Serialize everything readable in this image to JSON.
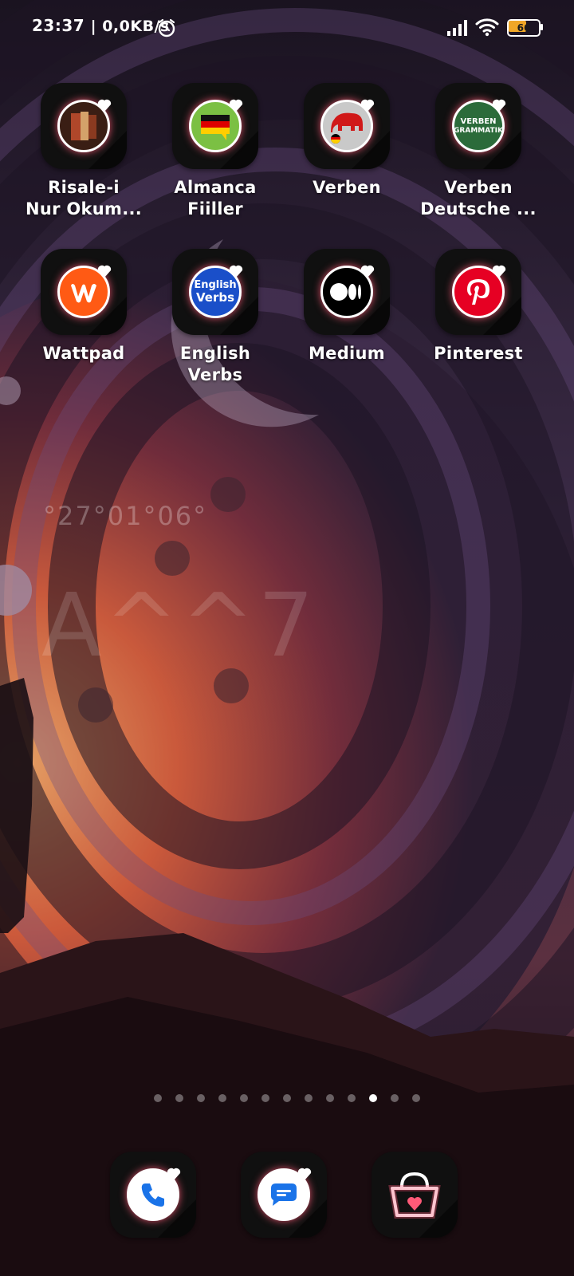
{
  "status_bar": {
    "time": "23:37",
    "net_speed": "| 0,0KB/s",
    "battery_level": "66",
    "icons": [
      "alarm-icon",
      "signal-icon",
      "wifi-icon",
      "battery-icon"
    ]
  },
  "widget": {
    "coordinates": "°27°01°06°",
    "big_text": "A^^7"
  },
  "apps": [
    {
      "name": "Risale-i",
      "name2": "Nur Okum...",
      "icon": "book-icon"
    },
    {
      "name": "Almanca",
      "name2": "Fiiller",
      "icon": "german-flag-chat-icon"
    },
    {
      "name": "Verben",
      "name2": "",
      "icon": "elephant-icon"
    },
    {
      "name": "Verben",
      "name2": "Deutsche ...",
      "icon": "verben-grammatik-icon"
    },
    {
      "name": "Wattpad",
      "name2": "",
      "icon": "wattpad-icon"
    },
    {
      "name": "English",
      "name2": "Verbs",
      "icon": "english-verbs-icon"
    },
    {
      "name": "Medium",
      "name2": "",
      "icon": "medium-icon"
    },
    {
      "name": "Pinterest",
      "name2": "",
      "icon": "pinterest-icon"
    }
  ],
  "app_icon_text": {
    "verben_grammatik": "VERBEN",
    "verben_grammatik2": "GRAMMATIK",
    "english_verbs1": "English",
    "english_verbs2": "Verbs"
  },
  "page_indicator": {
    "count": 13,
    "active_index": 10
  },
  "dock": [
    {
      "icon": "phone-icon"
    },
    {
      "icon": "messages-icon"
    },
    {
      "icon": "store-basket-icon"
    }
  ],
  "colors": {
    "accent_glow": "#ff5a78",
    "battery_fill": "#f0a727",
    "wattpad": "#ff5a14",
    "pinterest": "#e60023",
    "verben_green": "#2b6b3a"
  }
}
